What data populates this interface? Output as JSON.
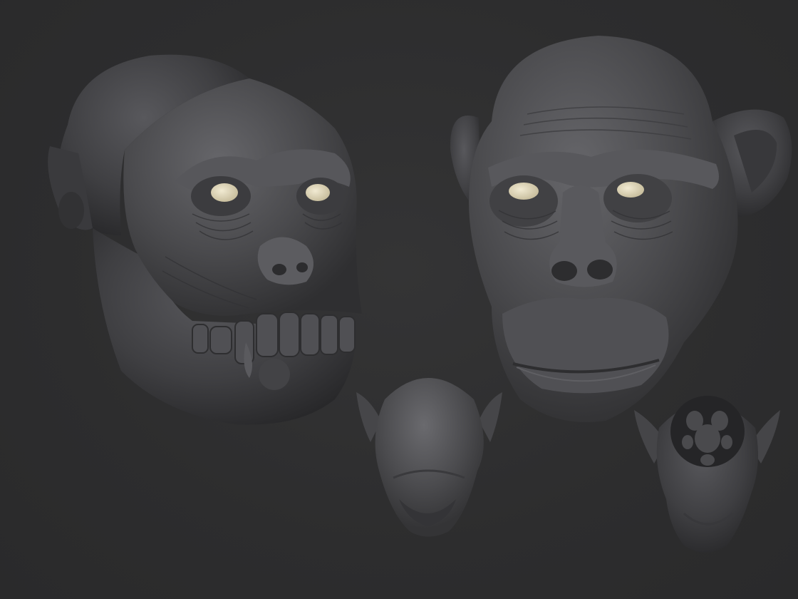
{
  "scene": {
    "background_color": "#2e2e2f",
    "material_color": "#4a4a4c",
    "eye_color": "#e3dcc3",
    "models": [
      {
        "id": "chimp-skull-with-partial-face",
        "view": "three-quarter"
      },
      {
        "id": "chimp-head-full",
        "view": "front"
      },
      {
        "id": "chimp-head-top",
        "view": "top"
      },
      {
        "id": "chimp-head-cutaway",
        "view": "bottom"
      }
    ]
  }
}
